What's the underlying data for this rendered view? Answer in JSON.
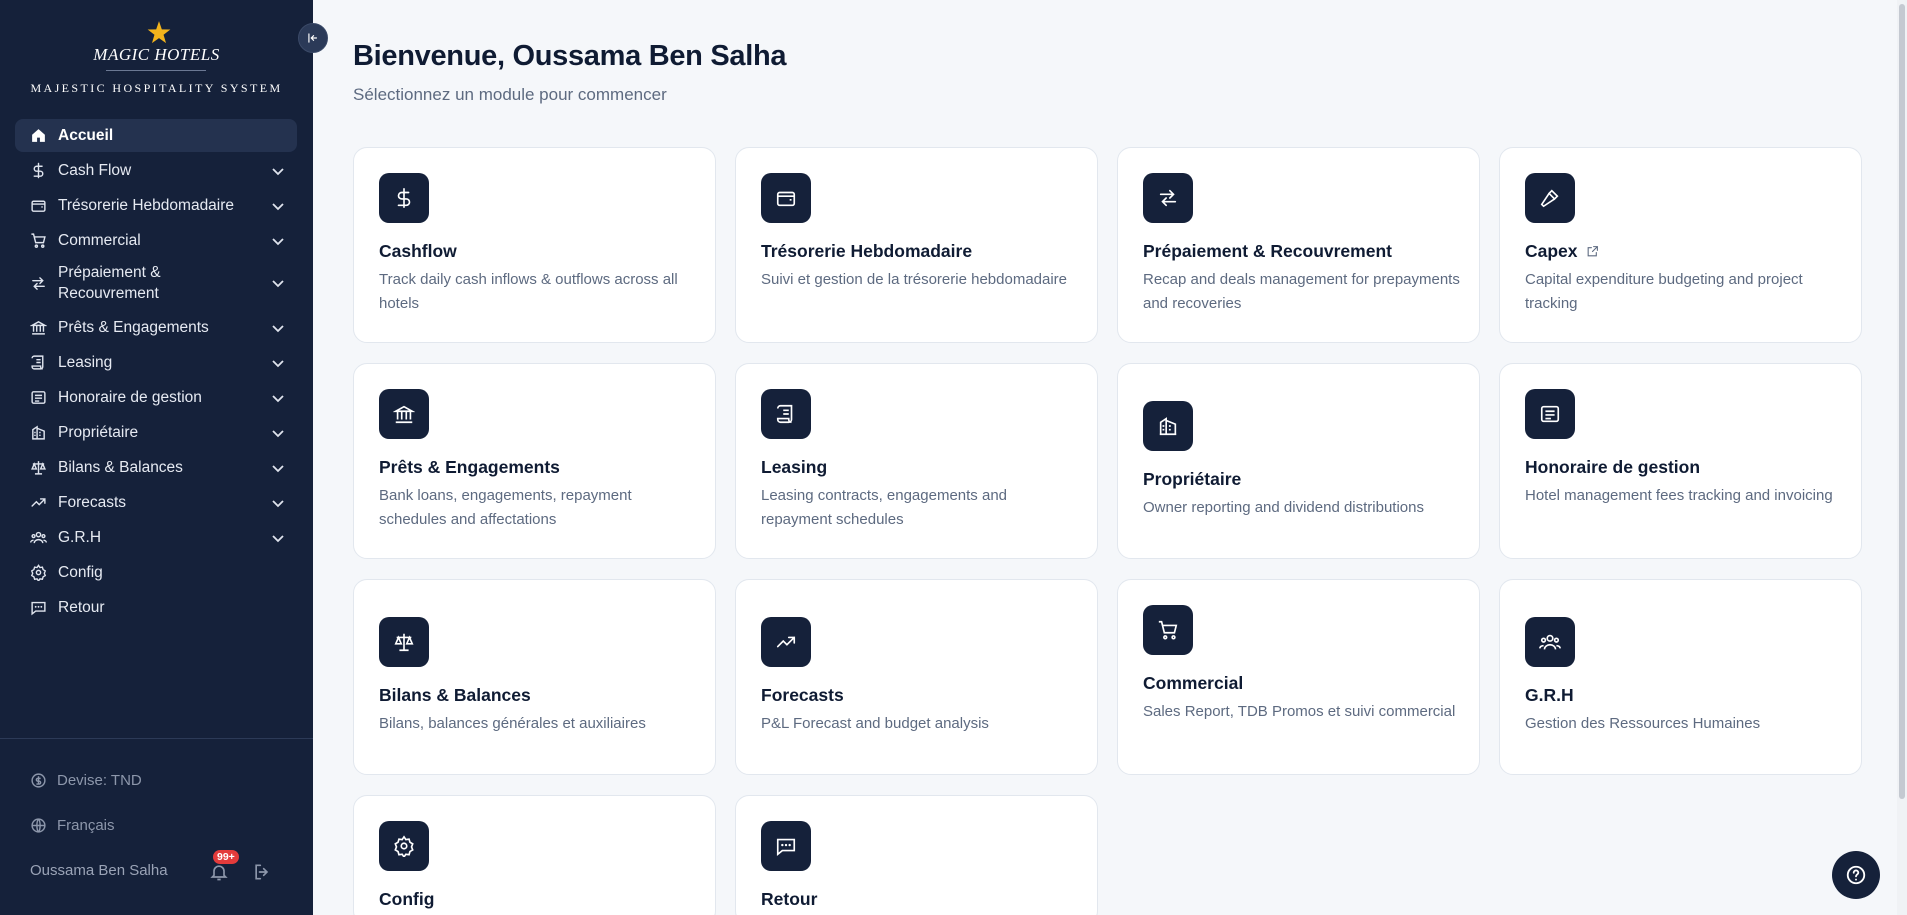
{
  "sidebar": {
    "brand": "MAGIC HOTELS",
    "brand_subtitle": "MAJESTIC HOSPITALITY SYSTEM",
    "items": [
      {
        "label": "Accueil",
        "icon": "home-icon"
      },
      {
        "label": "Cash Flow",
        "icon": "dollar-icon"
      },
      {
        "label": "Trésorerie Hebdomadaire",
        "icon": "wallet-icon"
      },
      {
        "label": "Commercial",
        "icon": "cart-icon"
      },
      {
        "label": "Prépaiement &",
        "label2": "Recouvrement",
        "icon": "arrows-icon"
      },
      {
        "label": "Prêts & Engagements",
        "icon": "bank-icon"
      },
      {
        "label": "Leasing",
        "icon": "scroll-icon"
      },
      {
        "label": "Honoraire de gestion",
        "icon": "receipt-icon"
      },
      {
        "label": "Propriétaire",
        "icon": "building-icon"
      },
      {
        "label": "Bilans & Balances",
        "icon": "scale-icon"
      },
      {
        "label": "Forecasts",
        "icon": "trend-icon"
      },
      {
        "label": "G.R.H",
        "icon": "users-icon"
      },
      {
        "label": "Config",
        "icon": "gear-icon"
      },
      {
        "label": "Retour",
        "icon": "message-icon"
      }
    ],
    "footer": {
      "currency": "Devise: TND",
      "language": "Français",
      "user": "Oussama Ben Salha",
      "notifications": "99+"
    }
  },
  "main": {
    "title": "Bienvenue, Oussama Ben Salha",
    "subtitle": "Sélectionnez un module pour commencer",
    "cards": [
      {
        "title": "Cashflow",
        "desc": "Track daily cash inflows & outflows across all hotels",
        "icon": "dollar-icon"
      },
      {
        "title": "Trésorerie Hebdomadaire",
        "desc": "Suivi et gestion de la trésorerie hebdomadaire",
        "icon": "wallet-icon"
      },
      {
        "title": "Prépaiement & Recouvrement",
        "desc": "Recap and deals management for prepayments and recoveries",
        "icon": "arrows-icon"
      },
      {
        "title": "Capex",
        "desc": "Capital expenditure budgeting and project tracking",
        "icon": "hammer-icon"
      },
      {
        "title": "Prêts & Engagements",
        "desc": "Bank loans, engagements, repayment schedules and affectations",
        "icon": "bank-icon"
      },
      {
        "title": "Leasing",
        "desc": "Leasing contracts, engagements and repayment schedules",
        "icon": "scroll-icon"
      },
      {
        "title": "Propriétaire",
        "desc": "Owner reporting and dividend distributions",
        "icon": "building-icon"
      },
      {
        "title": "Honoraire de gestion",
        "desc": "Hotel management fees tracking and invoicing",
        "icon": "receipt-icon"
      },
      {
        "title": "Bilans & Balances",
        "desc": "Bilans, balances générales et auxiliaires",
        "icon": "scale-icon"
      },
      {
        "title": "Forecasts",
        "desc": "P&L Forecast and budget analysis",
        "icon": "trend-icon"
      },
      {
        "title": "Commercial",
        "desc": "Sales Report, TDB Promos et suivi commercial",
        "icon": "cart-icon"
      },
      {
        "title": "G.R.H",
        "desc": "Gestion des Ressources Humaines",
        "icon": "users-icon"
      },
      {
        "title": "Config",
        "desc": "",
        "icon": "gear-icon"
      },
      {
        "title": "Retour",
        "desc": "",
        "icon": "message-icon"
      }
    ]
  },
  "colors": {
    "navy": "#15213a",
    "badge": "#e33b3b",
    "background": "#f5f7fa"
  }
}
